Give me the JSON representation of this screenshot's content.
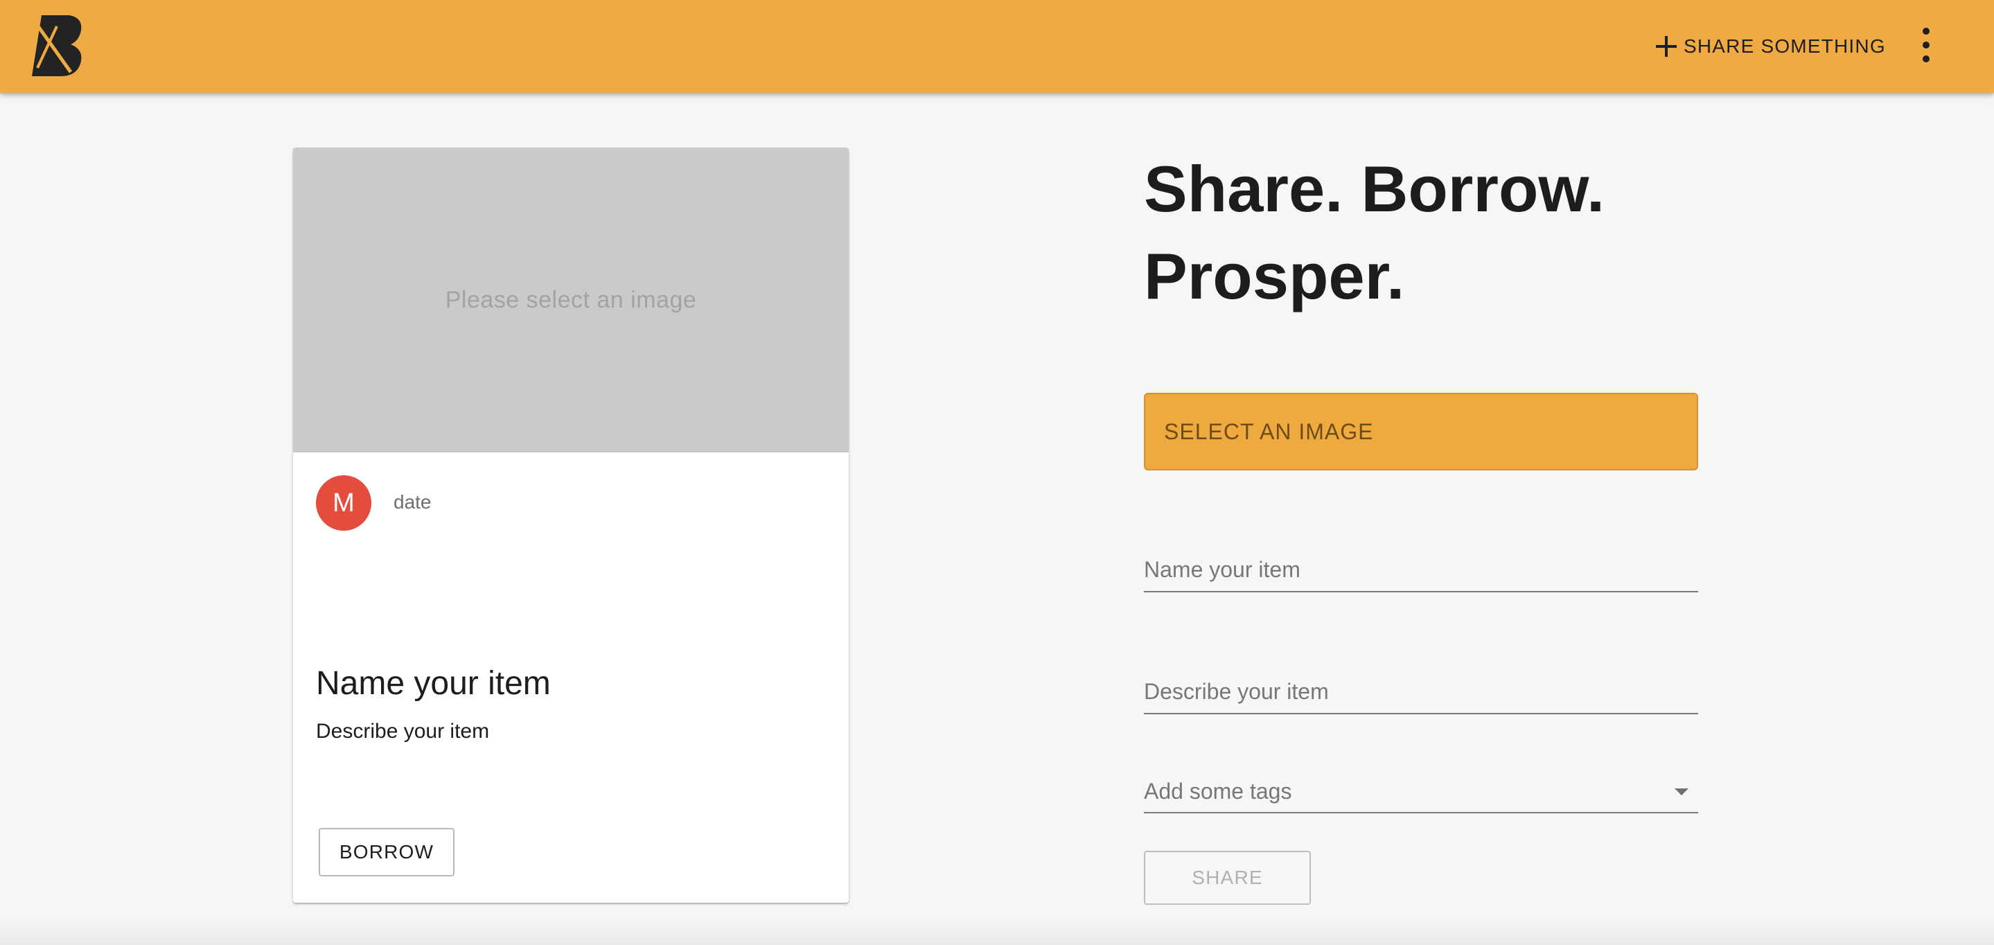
{
  "app": {
    "logo_icon": "boomtown-b-logo-icon",
    "accent_color": "#efaa44",
    "avatar_color": "#e44c3d"
  },
  "header": {
    "share_something_label": "SHARE SOMETHING",
    "plus_icon": "plus-icon",
    "more_icon": "more-vertical-icon"
  },
  "preview_card": {
    "image_placeholder": "Please select an image",
    "avatar_initial": "M",
    "date": "date",
    "title": "Name your item",
    "description": "Describe your item",
    "borrow_label": "BORROW"
  },
  "form": {
    "headline_line1": "Share. Borrow.",
    "headline_line2": "Prosper.",
    "select_image_label": "SELECT AN IMAGE",
    "name_placeholder": "Name your item",
    "description_placeholder": "Describe your item",
    "tags_placeholder": "Add some tags",
    "tags_dropdown_icon": "arrow-drop-down-icon",
    "share_label": "SHARE",
    "share_enabled": false
  }
}
